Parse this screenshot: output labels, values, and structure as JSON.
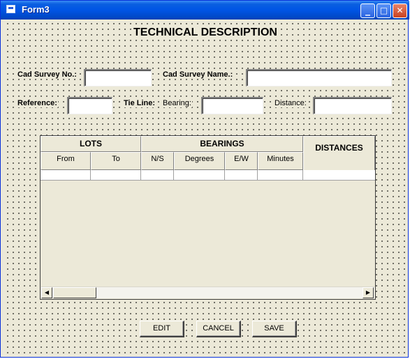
{
  "window": {
    "title": "Form3"
  },
  "titlebar": {
    "minimize": "_",
    "maximize": "□",
    "close": "✕"
  },
  "form": {
    "heading": "TECHNICAL DESCRIPTION",
    "cad_survey_no_label": "Cad Survey No.:",
    "cad_survey_no_value": "",
    "cad_survey_name_label": "Cad Survey Name.:",
    "cad_survey_name_value": "",
    "reference_label": "Reference:",
    "reference_value": "",
    "tie_line_label": "Tie Line:",
    "bearing_label": "Bearing:",
    "bearing_value": "",
    "distance_label": "Distance:",
    "distance_value": ""
  },
  "grid": {
    "groups": {
      "lots": "LOTS",
      "bearings": "BEARINGS",
      "distances": "DISTANCES"
    },
    "columns": [
      "From",
      "To",
      "N/S",
      "Degrees",
      "E/W",
      "Minutes"
    ],
    "rows": [
      [
        "",
        "",
        "",
        "",
        "",
        "",
        ""
      ]
    ],
    "scroll_left": "◀",
    "scroll_right": "▶"
  },
  "buttons": {
    "edit": "EDIT",
    "cancel": "CANCEL",
    "save": "SAVE"
  },
  "icons": {
    "app": "form-icon"
  }
}
